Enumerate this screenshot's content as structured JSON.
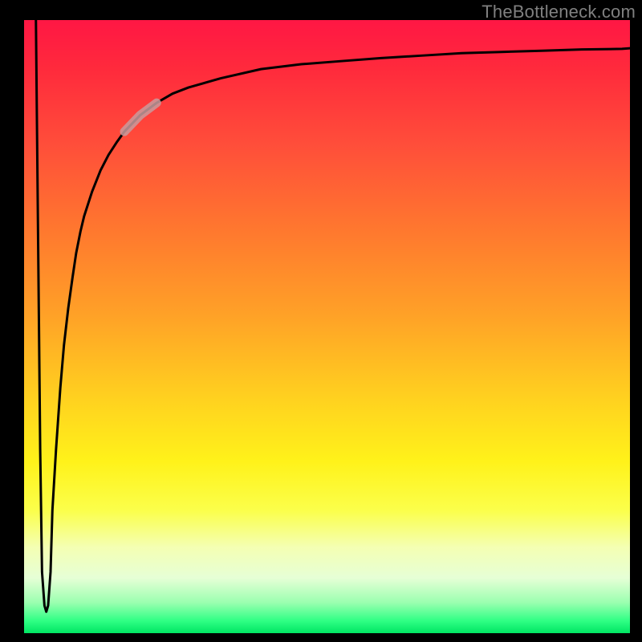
{
  "watermark": "TheBottleneck.com",
  "colors": {
    "curve": "#000000",
    "highlight": "#c99b9d",
    "frame": "#000000"
  },
  "chart_data": {
    "type": "line",
    "title": "",
    "xlabel": "",
    "ylabel": "",
    "xlim": [
      0,
      100
    ],
    "ylim": [
      0,
      100
    ],
    "grid": false,
    "series": [
      {
        "name": "bottleneck-curve",
        "x": [
          2.6,
          3.0,
          3.3,
          3.6,
          4.0,
          4.3,
          4.6,
          5.0,
          5.3,
          5.9,
          6.6,
          7.2,
          7.9,
          8.6,
          9.2,
          9.9,
          10.5,
          11.8,
          13.2,
          14.5,
          15.8,
          17.1,
          19.7,
          22.4,
          25.0,
          27.6,
          32.9,
          39.5,
          46.1,
          52.6,
          59.2,
          65.8,
          72.4,
          78.9,
          85.5,
          92.1,
          98.7,
          100.0
        ],
        "y": [
          100.0,
          60.0,
          30.0,
          10.0,
          4.5,
          3.5,
          4.5,
          10.0,
          20.0,
          30.0,
          40.0,
          47.0,
          53.0,
          58.0,
          62.0,
          65.5,
          68.0,
          72.0,
          75.5,
          78.0,
          80.0,
          81.8,
          84.5,
          86.5,
          88.0,
          89.0,
          90.5,
          92.0,
          92.8,
          93.3,
          93.8,
          94.2,
          94.6,
          94.8,
          95.0,
          95.2,
          95.3,
          95.4
        ]
      }
    ],
    "highlight_segment": {
      "x_start": 17.1,
      "x_end": 22.4
    }
  }
}
